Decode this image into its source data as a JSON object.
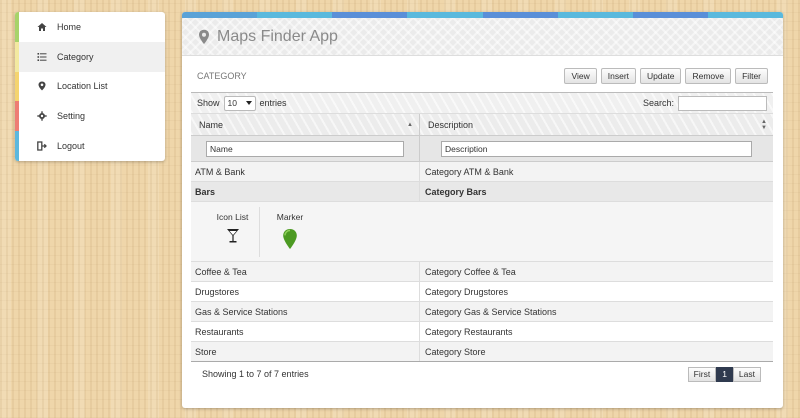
{
  "sidebar": {
    "items": [
      {
        "label": "Home",
        "icon": "home-icon"
      },
      {
        "label": "Category",
        "icon": "list-icon"
      },
      {
        "label": "Location List",
        "icon": "map-marker-icon"
      },
      {
        "label": "Setting",
        "icon": "gear-icon"
      },
      {
        "label": "Logout",
        "icon": "logout-icon"
      }
    ]
  },
  "colors": {
    "stripe": [
      "#5aa2d7",
      "#5ab9dd",
      "#5a8fd8",
      "#5ab9dd",
      "#5a8fd8",
      "#5ab9dd",
      "#5a8fd8",
      "#5ab9dd"
    ],
    "pager_active": "#2f3a4f"
  },
  "app": {
    "title": "Maps Finder App",
    "icon": "map-marker-icon"
  },
  "section": {
    "title": "CATEGORY"
  },
  "toolbar": {
    "view": "View",
    "insert": "Insert",
    "update": "Update",
    "remove": "Remove",
    "filter": "Filter"
  },
  "controls": {
    "show_label": "Show",
    "entries_value": "10",
    "entries_label": "entries",
    "search_label": "Search:"
  },
  "table": {
    "columns": [
      "Name",
      "Description"
    ],
    "filters": [
      "Name",
      "Description"
    ],
    "rows_before": [
      {
        "name": "ATM & Bank",
        "description": "Category ATM & Bank"
      }
    ],
    "selected": {
      "name": "Bars",
      "description": "Category Bars"
    },
    "detail": {
      "icon_list_label": "Icon List",
      "marker_label": "Marker",
      "icon": "cocktail-glass-icon",
      "marker": "map-marker-icon"
    },
    "rows_after": [
      {
        "name": "Coffee & Tea",
        "description": "Category Coffee & Tea"
      },
      {
        "name": "Drugstores",
        "description": "Category Drugstores"
      },
      {
        "name": "Gas & Service Stations",
        "description": "Category Gas & Service Stations"
      },
      {
        "name": "Restaurants",
        "description": "Category Restaurants"
      },
      {
        "name": "Store",
        "description": "Category Store"
      }
    ]
  },
  "footer": {
    "info": "Showing 1 to 7 of 7 entries",
    "first": "First",
    "page": "1",
    "last": "Last"
  }
}
